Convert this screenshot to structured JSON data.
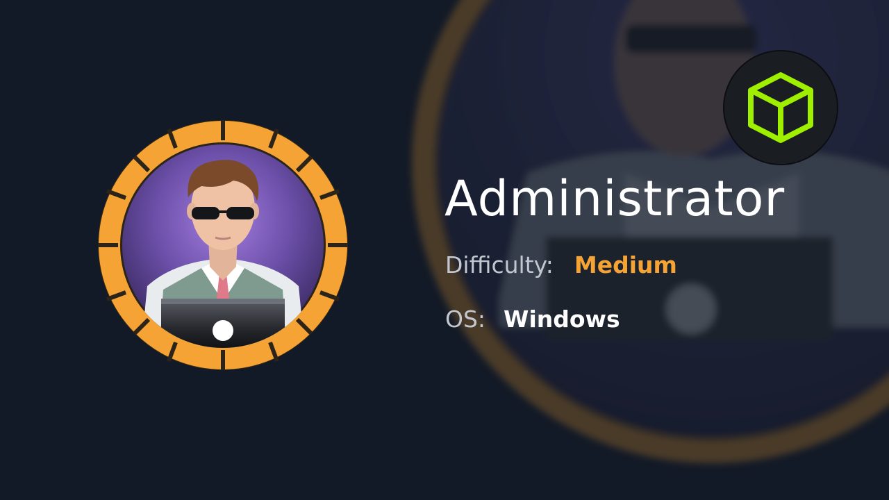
{
  "machine": {
    "name": "Administrator",
    "difficulty_label": "Difficulty:",
    "difficulty_value": "Medium",
    "os_label": "OS:",
    "os_value": "Windows"
  },
  "colors": {
    "background": "#131a27",
    "ring_orange": "#f5a335",
    "avatar_purple": "#6b4fa8",
    "title_text": "#ffffff",
    "label_text": "#c3c7cf",
    "difficulty_medium": "#f5a335",
    "os_value_text": "#ffffff",
    "logo_green": "#9fef00",
    "logo_badge_bg": "#1a1d22"
  },
  "icons": {
    "avatar": "hacker-avatar-icon",
    "logo": "hack-the-box-cube-icon"
  }
}
